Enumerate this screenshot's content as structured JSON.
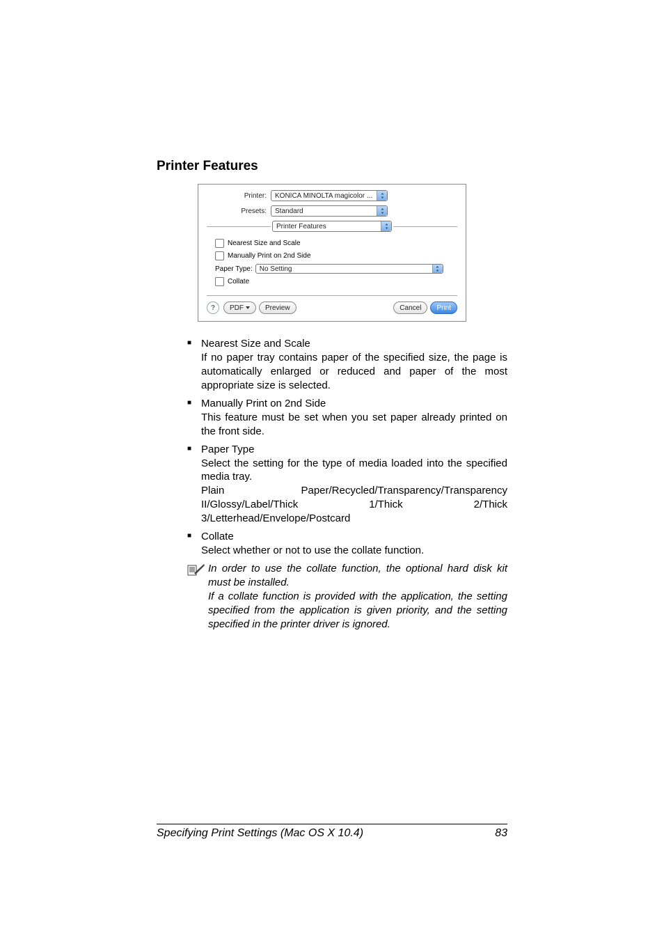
{
  "section_title": "Printer Features",
  "dialog": {
    "printer_label": "Printer:",
    "printer_value": "KONICA MINOLTA magicolor ...",
    "presets_label": "Presets:",
    "presets_value": "Standard",
    "pane_value": "Printer Features",
    "opt_nearest": "Nearest Size and Scale",
    "opt_manual": "Manually Print on 2nd Side",
    "paper_type_label": "Paper Type:",
    "paper_type_value": "No Setting",
    "opt_collate": "Collate",
    "help": "?",
    "pdf": "PDF",
    "preview": "Preview",
    "cancel": "Cancel",
    "print": "Print"
  },
  "bullets": {
    "b1_head": "Nearest Size and Scale",
    "b1_body": "If no paper tray contains paper of the specified size, the page is automatically enlarged or reduced and paper of the most appropriate size is selected.",
    "b2_head": "Manually Print on 2nd Side",
    "b2_body": "This feature must be set when you set paper already printed on the front side.",
    "b3_head": "Paper Type",
    "b3_body1": "Select the setting for the type of media loaded into the specified media tray.",
    "b3_body2": "Plain Paper/Recycled/Transparency/Transparency II/Glossy/Label/Thick 1/Thick 2/Thick 3/Letterhead/Envelope/Postcard",
    "b4_head": "Collate",
    "b4_body": "Select whether or not to use the collate function."
  },
  "note": {
    "p1": "In order to use the collate function, the optional hard disk kit must be installed.",
    "p2": "If a collate function is provided with the application, the setting specified from the application is given priority, and the setting specified in the printer driver is ignored."
  },
  "footer_left": "Specifying Print Settings (Mac OS X 10.4)",
  "footer_right": "83"
}
